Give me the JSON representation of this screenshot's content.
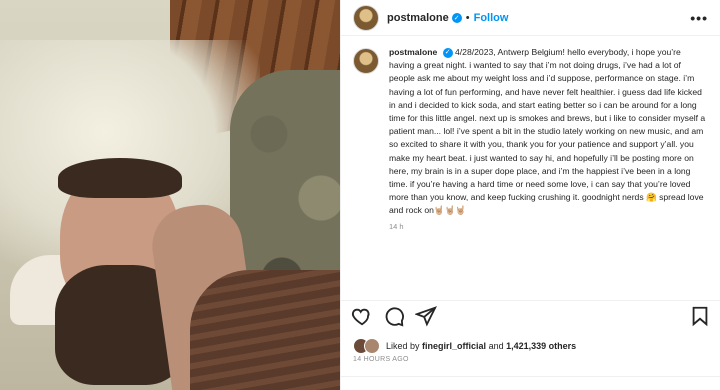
{
  "post": {
    "username": "postmalone",
    "follow_label": "Follow",
    "caption_text": "4/28/2023, Antwerp Belgium! hello everybody, i hope you’re having a great night. i wanted to say that i’m not doing drugs, i’ve had a lot of people ask me about my weight loss and i’d suppose, performance on stage. i’m having a lot of fun performing, and have never felt healthier. i guess dad life kicked in and i decided to kick soda, and start eating better so i can be around for a long time for this little angel. next up is smokes and brews, but i like to consider myself a patient man... lol! i’ve spent a bit in the studio lately working on new music, and am so excited to share it with you, thank you for your patience and support y’all. you make my heart beat. i just wanted to say hi, and hopefully i’ll be posting more on here, my brain is in a super dope place, and i’m the happiest i’ve been in a long time. if you’re having a hard time or need some love, i can say that you’re loved more than you know, and keep fucking crushing it. goodnight nerds 🤗 spread love and rock on🤘🏼🤘🏼🤘🏼",
    "caption_age": "14 h",
    "likes_prefix": "Liked by",
    "liked_by_user": "finegirl_official",
    "likes_and": "and",
    "likes_count": "1,421,339 others",
    "timestamp": "14 HOURS AGO"
  },
  "icons": {
    "verified": "verified-badge",
    "more": "more-options-icon",
    "like": "heart-icon",
    "comment": "comment-icon",
    "share": "share-icon",
    "save": "bookmark-icon"
  },
  "colors": {
    "accent": "#0095f6",
    "muted": "#8e8e8e",
    "text": "#262626"
  }
}
